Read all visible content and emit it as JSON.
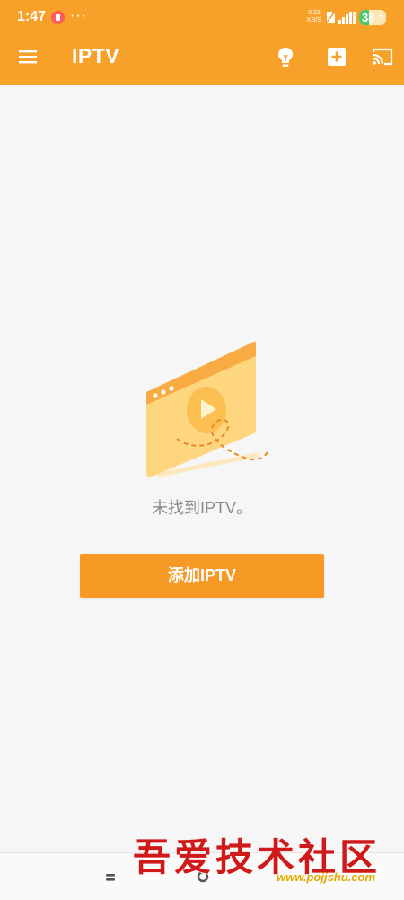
{
  "status_bar": {
    "time": "1:47",
    "more": "···",
    "net_speed_value": "0.22",
    "net_speed_unit": "KB/S",
    "battery": "38",
    "battery_level": 0.38
  },
  "toolbar": {
    "title": "IPTV",
    "menu_icon": "hamburger-menu-icon",
    "tips_icon": "lightbulb-icon",
    "add_icon": "add-box-icon",
    "cast_icon": "cast-icon"
  },
  "empty_state": {
    "message": "未找到IPTV。",
    "illustration": "video-player-illustration"
  },
  "add_button": {
    "label": "添加IPTV"
  },
  "nav_bar": {
    "menu_icon": "nav-menu-icon",
    "home_icon": "nav-home-icon"
  },
  "watermark": {
    "text": "吾爱技术社区",
    "url": "www.pojjshu.com"
  },
  "colors": {
    "primary": "#f7a12a",
    "button": "#f79a25",
    "background": "#f6f6f6",
    "empty_text": "#8a8a8a"
  }
}
